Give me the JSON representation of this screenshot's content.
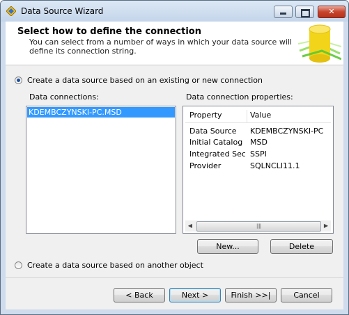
{
  "window": {
    "title": "Data Source Wizard"
  },
  "header": {
    "title": "Select how to define the connection",
    "description": "You can select from a number of ways in which your data source will define its connection string."
  },
  "options": {
    "existing": {
      "label": "Create a data source based on an existing or new connection",
      "checked": true
    },
    "other": {
      "label": "Create a data source based on another object",
      "checked": false
    }
  },
  "connections": {
    "caption": "Data connections:",
    "items": [
      "KDEMBCZYNSKI-PC.MSD"
    ],
    "selected": 0
  },
  "properties": {
    "caption": "Data connection properties:",
    "headers": {
      "property": "Property",
      "value": "Value"
    },
    "rows": [
      {
        "property": "Data Source",
        "value": "KDEMBCZYNSKI-PC"
      },
      {
        "property": "Initial Catalog",
        "value": "MSD"
      },
      {
        "property": "Integrated Sec...",
        "value": "SSPI"
      },
      {
        "property": "Provider",
        "value": "SQLNCLI11.1"
      }
    ]
  },
  "buttons": {
    "new": "New...",
    "delete": "Delete",
    "back": "< Back",
    "next": "Next >",
    "finish": "Finish >>|",
    "cancel": "Cancel"
  },
  "icons": {
    "app": "wizard-app-icon",
    "header": "database-cylinder-icon",
    "scroll_left": "chevron-left-icon",
    "scroll_right": "chevron-right-icon",
    "scroll_grip": "scroll-grip-icon"
  },
  "colors": {
    "selection": "#3399ff",
    "header_graphic": "#f2d51b",
    "accent_green": "#6ed13f"
  }
}
